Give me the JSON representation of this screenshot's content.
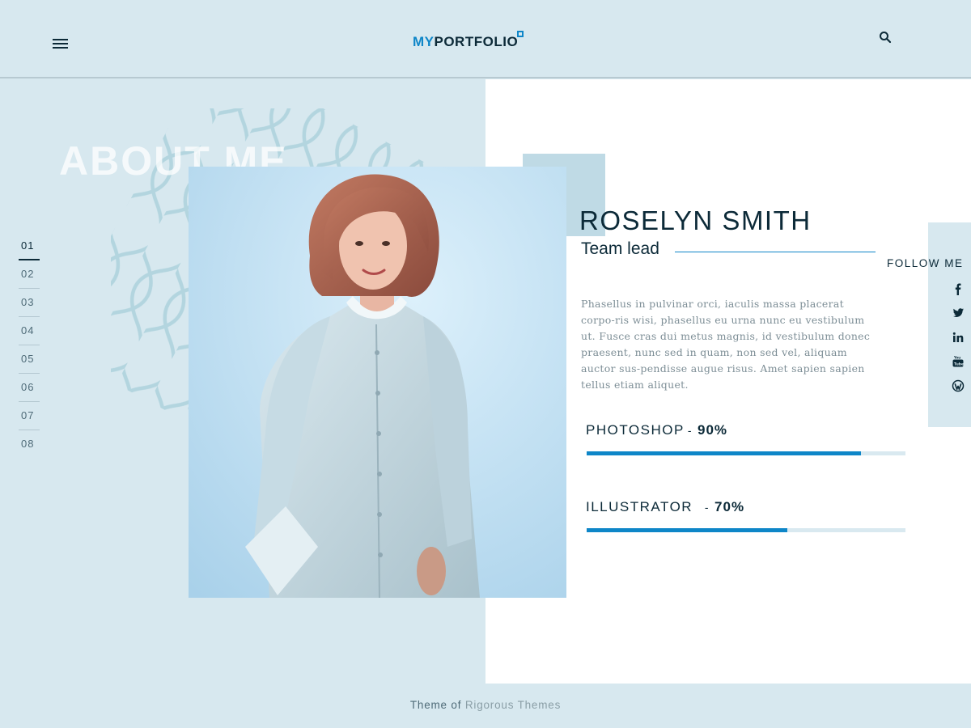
{
  "header": {
    "logo_prefix": "MY",
    "logo_suffix": "PORTFOLIO",
    "menu_icon": "hamburger-icon",
    "search_icon": "search-icon"
  },
  "section": {
    "title": "ABOUT ME"
  },
  "nav": {
    "items": [
      "01",
      "02",
      "03",
      "04",
      "05",
      "06",
      "07",
      "08"
    ],
    "active_index": 0
  },
  "profile": {
    "name": "ROSELYN SMITH",
    "role": "Team lead",
    "bio": "Phasellus in pulvinar orci, iaculis massa placerat corpo-ris wisi, phasellus eu urna nunc eu vestibulum ut. Fusce cras dui metus magnis, id vestibulum donec praesent, nunc sed in quam, non sed vel, aliquam auctor sus-pendisse augue risus. Amet sapien sapien tellus etiam aliquet."
  },
  "skills": [
    {
      "name": "PHOTOSHOP",
      "percent_label": "90%",
      "level": 0.86
    },
    {
      "name": "ILLUSTRATOR",
      "percent_label": "70%",
      "level": 0.63
    }
  ],
  "follow": {
    "label": "FOLLOW ME",
    "icons": [
      "facebook-icon",
      "twitter-icon",
      "linkedin-icon",
      "youtube-icon",
      "wordpress-icon"
    ]
  },
  "footer": {
    "prefix": "Theme of",
    "link": "Rigorous Themes"
  },
  "colors": {
    "background": "#d7e8ef",
    "accent": "#0e86c8",
    "text": "#0c2a38",
    "panel": "#ffffff"
  }
}
